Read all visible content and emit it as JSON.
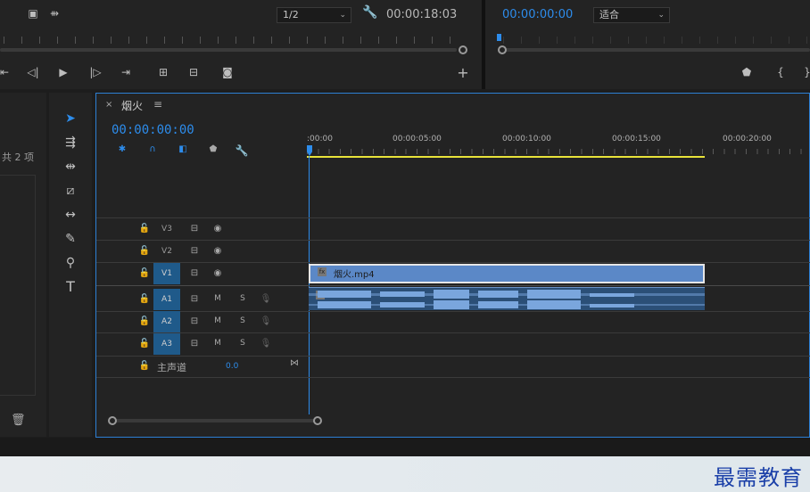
{
  "source_monitor": {
    "zoom_value": "1/2",
    "duration": "00:00:18:03"
  },
  "program_monitor": {
    "timecode": "00:00:00:00",
    "fit_value": "适合"
  },
  "project_panel": {
    "item_count": "共 2 项"
  },
  "timeline": {
    "sequence_name": "烟火",
    "playhead_timecode": "00:00:00:00",
    "ruler_labels": [
      ":00:00",
      "00:00:05:00",
      "00:00:10:00",
      "00:00:15:00",
      "00:00:20:00"
    ],
    "video_tracks": [
      {
        "label": "V3",
        "targeted": false
      },
      {
        "label": "V2",
        "targeted": false
      },
      {
        "label": "V1",
        "targeted": true
      }
    ],
    "audio_tracks": [
      {
        "label": "A1",
        "mute": "M",
        "solo": "S"
      },
      {
        "label": "A2",
        "mute": "M",
        "solo": "S"
      },
      {
        "label": "A3",
        "mute": "M",
        "solo": "S"
      }
    ],
    "master_label": "主声道",
    "master_value": "0.0",
    "video_clip_name": "烟火.mp4",
    "fx_badge": "fx"
  },
  "watermark": "最需教育",
  "colors": {
    "accent": "#2d8ceb",
    "track_target": "#1f5a8a",
    "video_clip": "#5b88c7",
    "audio_clip": "#2b4f77",
    "work_area": "#e8e23a"
  }
}
